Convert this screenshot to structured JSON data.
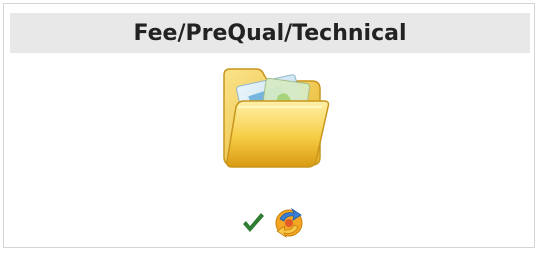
{
  "panel": {
    "title": "Fee/PreQual/Technical"
  },
  "icons": {
    "folder": "open-folder-icon",
    "status": "checkmark-icon",
    "refresh": "refresh-icon"
  },
  "colors": {
    "header_bg": "#e8e8e8",
    "checkmark": "#2e7d32",
    "folder_yellow": "#f5c542"
  }
}
